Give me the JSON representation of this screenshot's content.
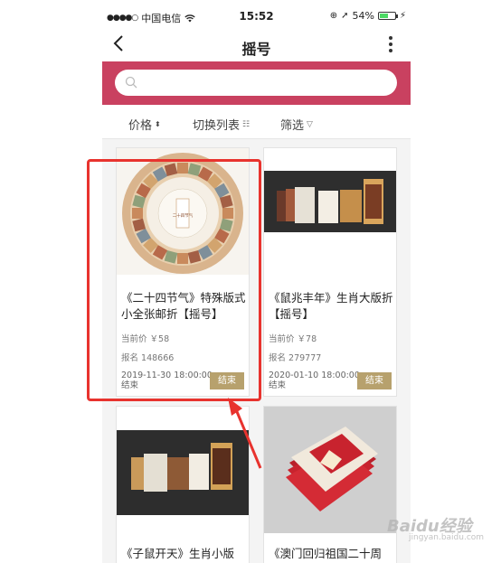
{
  "status_bar": {
    "signal": "●●●●○",
    "carrier": "中国电信",
    "time": "15:52",
    "battery": "54%",
    "battery_level": 0.54
  },
  "nav": {
    "title": "摇号"
  },
  "search": {
    "placeholder": ""
  },
  "filters": [
    {
      "label": "价格",
      "icon": "sort-updown-icon"
    },
    {
      "label": "切换列表",
      "icon": "list-icon"
    },
    {
      "label": "筛选",
      "icon": "funnel-icon"
    }
  ],
  "items": [
    {
      "name": "《二十四节气》特殊版式小全张邮折【摇号】",
      "price": "当前价 ￥58",
      "signup": "报名 148666",
      "date": "2019-11-30 18:00:00 结束",
      "button": "结束"
    },
    {
      "name": "《鼠兆丰年》生肖大版折【摇号】",
      "price": "当前价 ￥78",
      "signup": "报名 279777",
      "date": "2020-01-10 18:00:00 结束",
      "button": "结束"
    },
    {
      "name": "《子鼠开天》生肖小版",
      "image": "stamp-folder-open"
    },
    {
      "name": "《澳门回归祖国二十周",
      "image": "red-folder-stack"
    }
  ],
  "watermark": {
    "text": "Baidu经验",
    "sub": "jingyan.baidu.com"
  },
  "colors": {
    "accent": "#c94160",
    "button": "#b7a16d",
    "highlight": "#e8332e"
  }
}
